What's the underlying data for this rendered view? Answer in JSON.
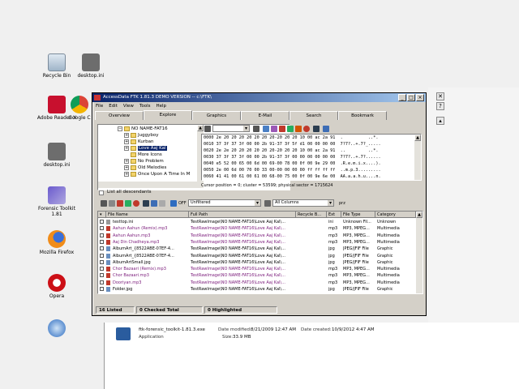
{
  "desktop": {
    "icons": [
      {
        "label": "Recycle Bin",
        "icon": "recycle-bin-icon"
      },
      {
        "label": "desktop.ini",
        "icon": "ini-file-icon"
      },
      {
        "label": "Adobe Reader X",
        "icon": "adobe-reader-icon"
      },
      {
        "label": "Google C",
        "icon": "chrome-icon"
      },
      {
        "label": "desktop.ini",
        "icon": "ini-file-icon"
      },
      {
        "label": "Forensic Toolkit 1.81",
        "icon": "ftk-icon"
      },
      {
        "label": "Mozilla Firefox",
        "icon": "firefox-icon"
      },
      {
        "label": "Opera",
        "icon": "opera-icon"
      }
    ]
  },
  "explorer_details": {
    "filename": "ftk-forensic_toolkit-1.81.3.exe",
    "date_modified_label": "Date modified:",
    "date_modified": "8/21/2009 12:47 AM",
    "date_created_label": "Date created:",
    "date_created": "10/9/2012 4:47 AM",
    "type": "Application",
    "size_label": "Size:",
    "size": "33.9 MB"
  },
  "window": {
    "title": "AccessData FTK 1.81.3 DEMO VERSION -- c:\\FTK\\",
    "menu": [
      "File",
      "Edit",
      "View",
      "Tools",
      "Help"
    ],
    "tabs": [
      "Overview",
      "Explore",
      "Graphics",
      "E-Mail",
      "Search",
      "Bookmark"
    ],
    "active_tab": "Explore"
  },
  "tree": {
    "root": "NO NAME-FAT16",
    "items": [
      "Juggyboy",
      "Kurban",
      "Love Aaj Kal",
      "More Icons",
      "No Problem",
      "Old Melodies",
      "Once Upon A Time In M"
    ],
    "selected": "Love Aaj Kal",
    "list_all_label": "List all descendants"
  },
  "hex": {
    "rows": [
      "0000 2e 20 20 20 20 20 20 20-20 20 20 10 00 ac 2a 91  .          ..*.",
      "0010 37 3f 37 3f 00 00 2b 91-37 3f 5f d1 00 00 00 00  7?7?..+.7?_.....",
      "0020 2e 2e 20 20 20 20 20 20-20 20 20 10 00 ac 2a 91  ..         ..*.",
      "0030 37 3f 37 3f 00 00 2b 91-37 3f 00 00 00 00 00 00  7?7?..+.7?......",
      "0040 e5 52 00 65 00 6d 00 69-00 78 00 0f 00 9e 29 00  .R.e.m.i.x....).",
      "0050 2e 00 6d 00 70 00 33 00-00 00 00 00 ff ff ff ff  ..m.p.3.........",
      "0060 41 41 00 61 00 61 00 68-00 75 00 0f 00 9e 6e 00  AA.a.a.h.u....n."
    ],
    "cursor_position": "Cursor position = 0; cluster = 53599; physical sector = 1715624"
  },
  "filter": {
    "filter_toggle": "OFF",
    "filter_value": "Unfiltered",
    "columns_value": "All Columns",
    "extra": "prz"
  },
  "file_list": {
    "columns": [
      "File Name",
      "Full Path",
      "Recycle B...",
      "Ext",
      "File Type",
      "Category"
    ],
    "rows": [
      {
        "name": "testtop.ini",
        "path": "TestRawImage\\NO NAME-FAT16\\Love Aaj Kal\\...",
        "ext": "ini",
        "type": "Unknown Fil...",
        "category": "Unknown",
        "purple": false
      },
      {
        "name": "Aahun Aahun (Remix).mp3",
        "path": "TestRawImage\\NO NAME-FAT16\\Love Aaj Kal\\...",
        "ext": "mp3",
        "type": "MP3, MPEG...",
        "category": "Multimedia",
        "purple": true
      },
      {
        "name": "Aahun Aahun.mp3",
        "path": "TestRawImage\\NO NAME-FAT16\\Love Aaj Kal\\...",
        "ext": "mp3",
        "type": "MP3, MPEG...",
        "category": "Multimedia",
        "purple": true
      },
      {
        "name": "Aaj Din Chadheya.mp3",
        "path": "TestRawImage\\NO NAME-FAT16\\Love Aaj Kal\\...",
        "ext": "mp3",
        "type": "MP3, MPEG...",
        "category": "Multimedia",
        "purple": true
      },
      {
        "name": "AlbumArt_{8522ABE-07EF-4...",
        "path": "TestRawImage\\NO NAME-FAT16\\Love Aaj Kal\\...",
        "ext": "jpg",
        "type": "JPEG/JFIF File",
        "category": "Graphic",
        "purple": false
      },
      {
        "name": "AlbumArt_{8522ABE-07EF-4...",
        "path": "TestRawImage\\NO NAME-FAT16\\Love Aaj Kal\\...",
        "ext": "jpg",
        "type": "JPEG/JFIF File",
        "category": "Graphic",
        "purple": false
      },
      {
        "name": "AlbumArtSmall.jpg",
        "path": "TestRawImage\\NO NAME-FAT16\\Love Aaj Kal\\...",
        "ext": "jpg",
        "type": "JPEG/JFIF File",
        "category": "Graphic",
        "purple": false
      },
      {
        "name": "Chor Bazaari (Remix).mp3",
        "path": "TestRawImage\\NO NAME-FAT16\\Love Aaj Kal\\...",
        "ext": "mp3",
        "type": "MP3, MPEG...",
        "category": "Multimedia",
        "purple": true
      },
      {
        "name": "Chor Bazaari.mp3",
        "path": "TestRawImage\\NO NAME-FAT16\\Love Aaj Kal\\...",
        "ext": "mp3",
        "type": "MP3, MPEG...",
        "category": "Multimedia",
        "purple": true
      },
      {
        "name": "Dooriyan.mp3",
        "path": "TestRawImage\\NO NAME-FAT16\\Love Aaj Kal\\...",
        "ext": "mp3",
        "type": "MP3, MPEG...",
        "category": "Multimedia",
        "purple": true
      },
      {
        "name": "Folder.jpg",
        "path": "TestRawImage\\NO NAME-FAT16\\Love Aaj Kal\\...",
        "ext": "jpg",
        "type": "JPEG/JFIF File",
        "category": "Graphic",
        "purple": false
      }
    ]
  },
  "status": {
    "listed": "16 Listed",
    "checked": "0 Checked Total",
    "highlighted": "0 Highlighted"
  },
  "colors": {
    "title_gradient_start": "#0a246a",
    "title_gradient_end": "#a6caf0",
    "path_purple": "#7a1a7a",
    "selection": "#0a246a"
  }
}
